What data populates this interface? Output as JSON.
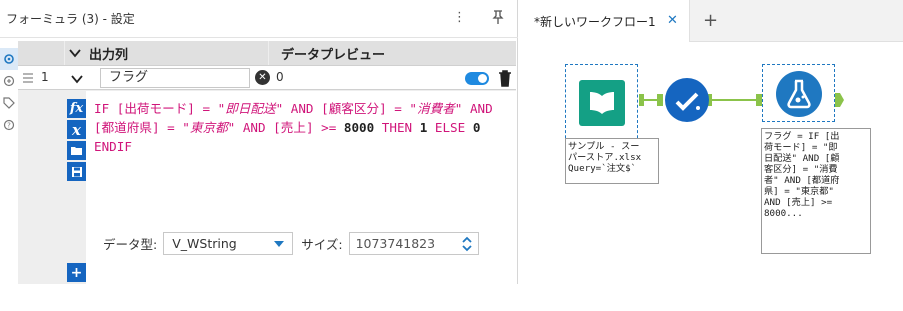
{
  "config_panel": {
    "title": "フォーミュラ (3) - 設定",
    "columns": {
      "output": "出力列",
      "preview": "データプレビュー"
    },
    "row": {
      "index": "1",
      "field_name": "フラグ",
      "preview_value": "0"
    },
    "formula": {
      "segments": [
        {
          "text": "IF ",
          "style": "k"
        },
        {
          "text": "[出荷モード]",
          "style": "k"
        },
        {
          "text": " = ",
          "style": "k"
        },
        {
          "text": "\"即日配送\"",
          "style": "s"
        },
        {
          "text": " AND ",
          "style": "k"
        },
        {
          "text": "[顧客区分]",
          "style": "k"
        },
        {
          "text": " = ",
          "style": "k"
        },
        {
          "text": "\"消費者\"",
          "style": "s"
        },
        {
          "text": " AND ",
          "style": "k"
        },
        {
          "text": "[都道府県]",
          "style": "k"
        },
        {
          "text": " = ",
          "style": "k"
        },
        {
          "text": "\"東京都\"",
          "style": "s"
        },
        {
          "text": " AND ",
          "style": "k"
        },
        {
          "text": "[売上]",
          "style": "k"
        },
        {
          "text": " >= ",
          "style": "k"
        },
        {
          "text": "8000",
          "style": "t"
        },
        {
          "text": " THEN ",
          "style": "k"
        },
        {
          "text": "1",
          "style": "t"
        },
        {
          "text": " ELSE ",
          "style": "k"
        },
        {
          "text": "0",
          "style": "t"
        },
        {
          "text": " ENDIF",
          "style": "k"
        }
      ]
    },
    "datatype_label": "データ型:",
    "datatype_value": "V_WString",
    "size_label": "サイズ:",
    "size_value": "1073741823"
  },
  "workflow": {
    "tab_label": "*新しいワークフロー1",
    "input_label": "サンプル - スー\nパーストア.xlsx\nQuery=`注文$`",
    "formula_label": "フラグ = IF [出\n荷モード] = \"即\n日配送\" AND [顧\n客区分] = \"消費\n者\" AND [都道府\n県] = \"東京都\"\nAND [売上] >=\n8000..."
  },
  "colors": {
    "accent": "#1f78c1",
    "input_tool": "#14a085",
    "filter_tool": "#1565c0",
    "formula_tool": "#1f78c1",
    "connector": "#8bc34a"
  }
}
